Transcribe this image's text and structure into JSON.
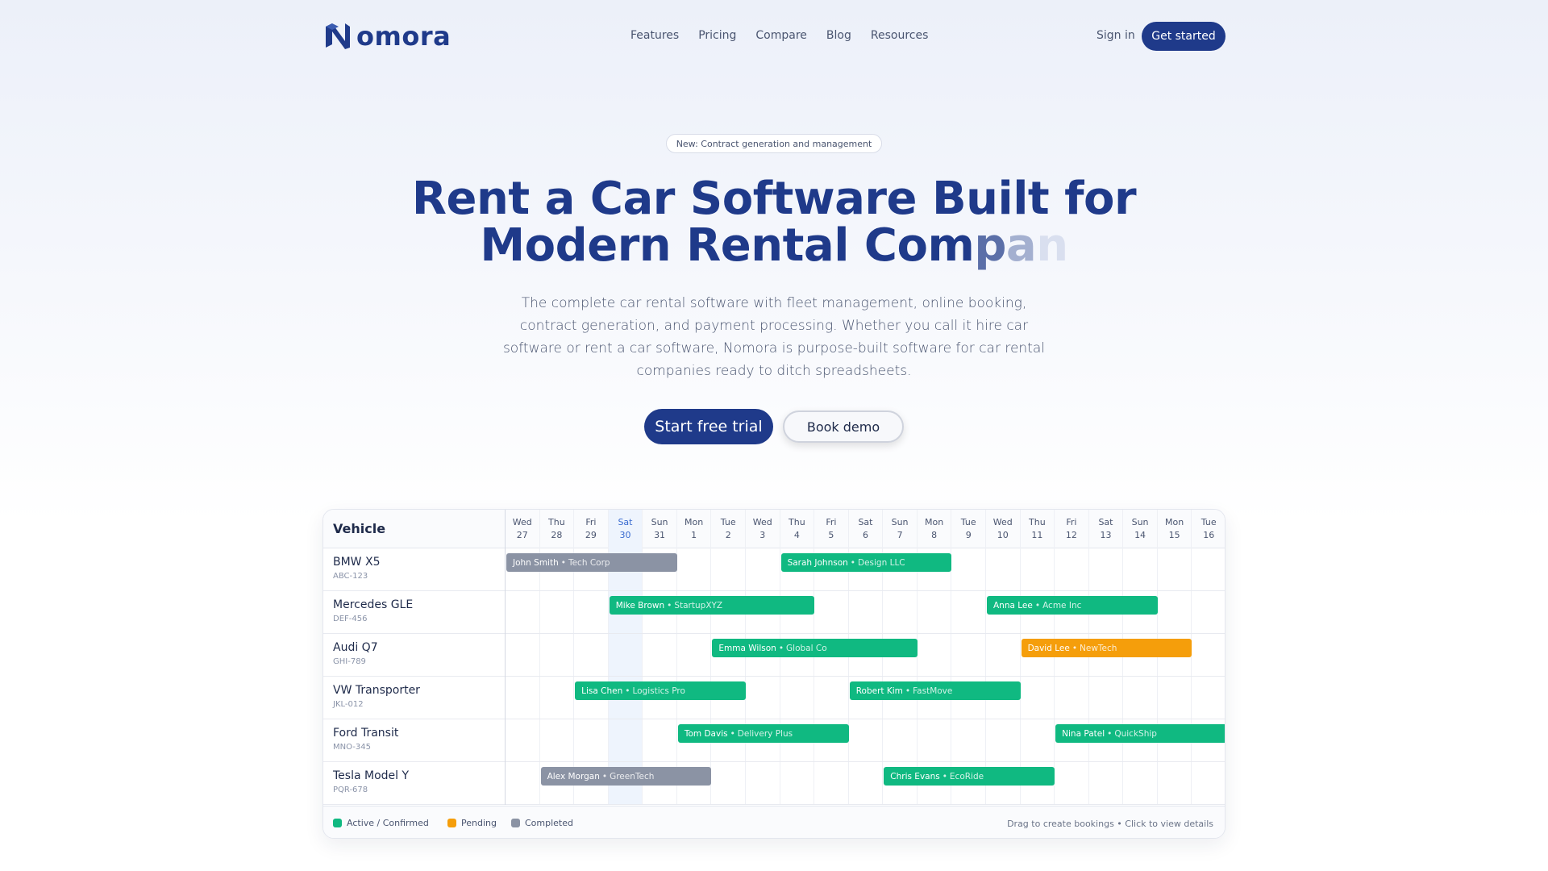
{
  "brand": {
    "name": "omora",
    "logo_letter": "N",
    "color": "#1f3a8a"
  },
  "nav": {
    "links": [
      "Features",
      "Pricing",
      "Compare",
      "Blog",
      "Resources"
    ],
    "sign_in": "Sign in",
    "cta": "Get started"
  },
  "hero": {
    "badge": "New: Contract generation and management",
    "headline_line1": "Rent a Car Software Built for",
    "headline_line2_solid": "Modern Rental Com",
    "headline_line2_fade1": "p",
    "headline_line2_fade2": "a",
    "headline_line2_fade3": "n",
    "subtext": "The complete car rental software with fleet management, online booking, contract generation, and payment processing. Whether you call it hire car software or rent a car software, Nomora is purpose-built software for car rental companies ready to ditch spreadsheets.",
    "primary_button": "Start free trial",
    "secondary_button": "Book demo"
  },
  "scheduler": {
    "vehicle_header": "Vehicle",
    "today_index": 3,
    "days": [
      {
        "dow": "Wed",
        "num": "27"
      },
      {
        "dow": "Thu",
        "num": "28"
      },
      {
        "dow": "Fri",
        "num": "29"
      },
      {
        "dow": "Sat",
        "num": "30"
      },
      {
        "dow": "Sun",
        "num": "31"
      },
      {
        "dow": "Mon",
        "num": "1"
      },
      {
        "dow": "Tue",
        "num": "2"
      },
      {
        "dow": "Wed",
        "num": "3"
      },
      {
        "dow": "Thu",
        "num": "4"
      },
      {
        "dow": "Fri",
        "num": "5"
      },
      {
        "dow": "Sat",
        "num": "6"
      },
      {
        "dow": "Sun",
        "num": "7"
      },
      {
        "dow": "Mon",
        "num": "8"
      },
      {
        "dow": "Tue",
        "num": "9"
      },
      {
        "dow": "Wed",
        "num": "10"
      },
      {
        "dow": "Thu",
        "num": "11"
      },
      {
        "dow": "Fri",
        "num": "12"
      },
      {
        "dow": "Sat",
        "num": "13"
      },
      {
        "dow": "Sun",
        "num": "14"
      },
      {
        "dow": "Mon",
        "num": "15"
      },
      {
        "dow": "Tue",
        "num": "16"
      }
    ],
    "vehicles": [
      {
        "name": "BMW X5",
        "plate": "ABC-123",
        "bookings": [
          {
            "client": "John Smith",
            "company": "Tech Corp",
            "start": 0,
            "days": 5,
            "status": "completed"
          },
          {
            "client": "Sarah Johnson",
            "company": "Design LLC",
            "start": 8,
            "days": 5,
            "status": "active"
          }
        ]
      },
      {
        "name": "Mercedes GLE",
        "plate": "DEF-456",
        "bookings": [
          {
            "client": "Mike Brown",
            "company": "StartupXYZ",
            "start": 3,
            "days": 6,
            "status": "active"
          },
          {
            "client": "Anna Lee",
            "company": "Acme Inc",
            "start": 14,
            "days": 5,
            "status": "active"
          }
        ]
      },
      {
        "name": "Audi Q7",
        "plate": "GHI-789",
        "bookings": [
          {
            "client": "Emma Wilson",
            "company": "Global Co",
            "start": 6,
            "days": 6,
            "status": "active"
          },
          {
            "client": "David Lee",
            "company": "NewTech",
            "start": 15,
            "days": 5,
            "status": "pending"
          }
        ]
      },
      {
        "name": "VW Transporter",
        "plate": "JKL-012",
        "bookings": [
          {
            "client": "Lisa Chen",
            "company": "Logistics Pro",
            "start": 2,
            "days": 5,
            "status": "active"
          },
          {
            "client": "Robert Kim",
            "company": "FastMove",
            "start": 10,
            "days": 5,
            "status": "active"
          }
        ]
      },
      {
        "name": "Ford Transit",
        "plate": "MNO-345",
        "bookings": [
          {
            "client": "Tom Davis",
            "company": "Delivery Plus",
            "start": 5,
            "days": 5,
            "status": "active"
          },
          {
            "client": "Nina Patel",
            "company": "QuickShip",
            "start": 16,
            "days": 5,
            "status": "active"
          }
        ]
      },
      {
        "name": "Tesla Model Y",
        "plate": "PQR-678",
        "bookings": [
          {
            "client": "Alex Morgan",
            "company": "GreenTech",
            "start": 1,
            "days": 5,
            "status": "completed"
          },
          {
            "client": "Chris Evans",
            "company": "EcoRide",
            "start": 11,
            "days": 5,
            "status": "active"
          }
        ]
      }
    ],
    "status_colors": {
      "active": "#10b981",
      "pending": "#f59e0b",
      "completed": "#8b93a4"
    },
    "legend": [
      {
        "label": "Active / Confirmed",
        "status": "active"
      },
      {
        "label": "Pending",
        "status": "pending"
      },
      {
        "label": "Completed",
        "status": "completed"
      }
    ],
    "hint": "Drag to create bookings • Click to view details"
  }
}
